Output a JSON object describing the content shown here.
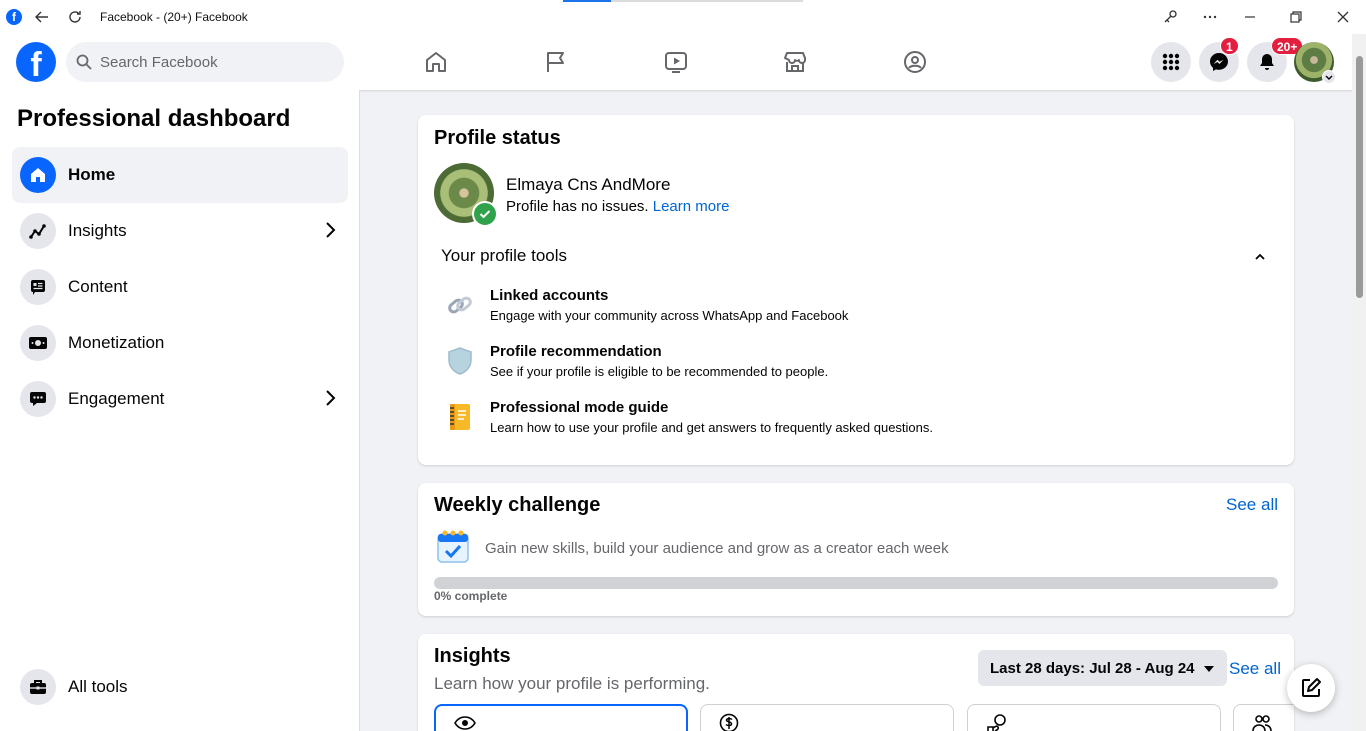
{
  "window": {
    "title": "Facebook - (20+) Facebook"
  },
  "header": {
    "logo": "f",
    "search_placeholder": "Search Facebook",
    "messenger_badge": "1",
    "notifications_badge": "20+"
  },
  "sidebar": {
    "title": "Professional dashboard",
    "items": [
      {
        "label": "Home",
        "icon": "home-icon",
        "active": true
      },
      {
        "label": "Insights",
        "icon": "insights-icon",
        "has_chevron": true
      },
      {
        "label": "Content",
        "icon": "content-icon"
      },
      {
        "label": "Monetization",
        "icon": "money-icon"
      },
      {
        "label": "Engagement",
        "icon": "chat-icon",
        "has_chevron": true
      }
    ],
    "bottom_item": {
      "label": "All tools",
      "icon": "toolbox-icon"
    }
  },
  "profile_status": {
    "title": "Profile status",
    "name": "Elmaya Cns AndMore",
    "status_text": "Profile has no issues.",
    "learn_more": "Learn more",
    "tools_title": "Your profile tools",
    "tools": [
      {
        "title": "Linked accounts",
        "desc": "Engage with your community across WhatsApp and Facebook",
        "icon": "link-icon"
      },
      {
        "title": "Profile recommendation",
        "desc": "See if your profile is eligible to be recommended to people.",
        "icon": "shield-icon"
      },
      {
        "title": "Professional mode guide",
        "desc": "Learn how to use your profile and get answers to frequently asked questions.",
        "icon": "guidebook-icon"
      }
    ]
  },
  "weekly_challenge": {
    "title": "Weekly challenge",
    "see_all": "See all",
    "desc": "Gain new skills, build your audience and grow as a creator each week",
    "progress_label": "0% complete",
    "progress_fraction": 0
  },
  "insights": {
    "title": "Insights",
    "subtitle": "Learn how your profile is performing.",
    "date_range": "Last 28 days: Jul 28 - Aug 24",
    "see_all": "See all"
  },
  "colors": {
    "brand": "#0866ff",
    "link": "#0064d1",
    "badge": "#e41e3f",
    "success": "#31a24c"
  }
}
